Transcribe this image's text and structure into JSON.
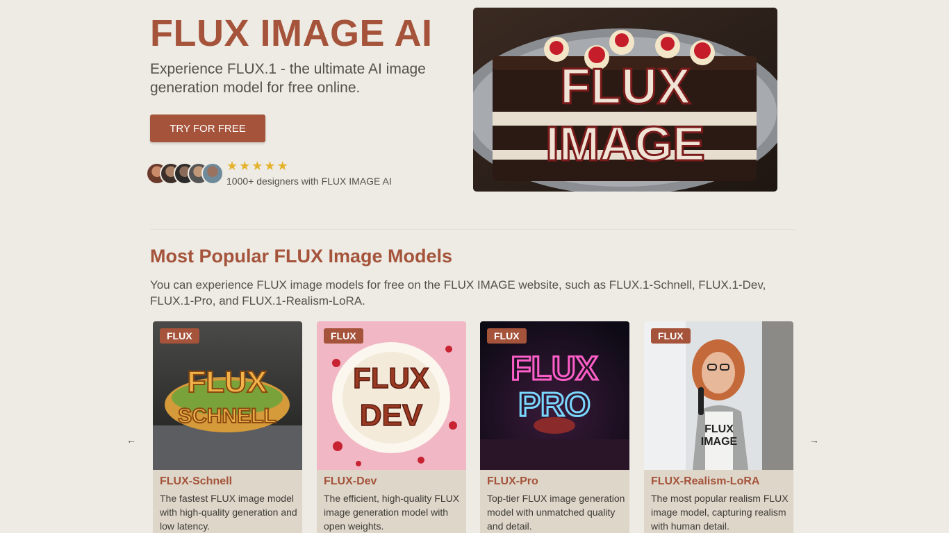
{
  "hero": {
    "title": "FLUX IMAGE AI",
    "subtitle": "Experience FLUX.1 - the ultimate AI image generation model for free online.",
    "cta_label": "TRY FOR FREE",
    "rating_stars": 5,
    "designers_text": "1000+ designers with FLUX IMAGE AI",
    "image_text_top": "FLUX",
    "image_text_bottom": "IMAGE"
  },
  "models_section": {
    "title": "Most Popular FLUX Image Models",
    "description": "You can experience FLUX image models for free on the FLUX IMAGE website, such as FLUX.1-Schnell, FLUX.1-Dev, FLUX.1-Pro, and FLUX.1-Realism-LoRA.",
    "prev_icon": "arrow-left-icon",
    "next_icon": "arrow-right-icon",
    "cards": [
      {
        "badge": "FLUX",
        "title": "FLUX-Schnell",
        "description": "The fastest FLUX image model with high-quality generation and low latency.",
        "image_text_1": "FLUX",
        "image_text_2": "SCHNELL"
      },
      {
        "badge": "FLUX",
        "title": "FLUX-Dev",
        "description": "The efficient, high-quality FLUX image generation model with open weights.",
        "image_text_1": "FLUX",
        "image_text_2": "DEV"
      },
      {
        "badge": "FLUX",
        "title": "FLUX-Pro",
        "description": "Top-tier FLUX image generation model with unmatched quality and detail.",
        "image_text_1": "FLUX",
        "image_text_2": "PRO"
      },
      {
        "badge": "FLUX",
        "title": "FLUX-Realism-LoRA",
        "description": "The most popular realism FLUX image model, capturing realism with human detail.",
        "image_text_1": "FLUX",
        "image_text_2": "IMAGE"
      }
    ]
  },
  "colors": {
    "background": "#edebe4",
    "accent": "#a5533a",
    "card_bg": "#ddd6c9",
    "star": "#e5b22b"
  }
}
